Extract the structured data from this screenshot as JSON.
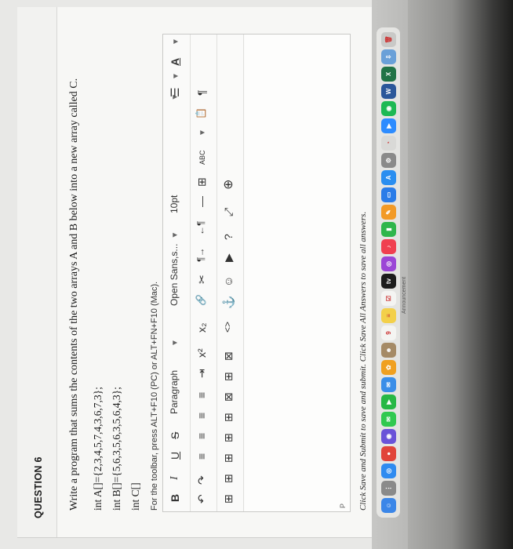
{
  "question": {
    "heading": "QUESTION 6",
    "prompt": "Write a program that sums the contents of the two arrays A and B below into a new array called C.",
    "code_lines": [
      "int A[]={2,3,4,5,7,4,3,6,7,3};",
      "int B[]={5,6,3,5,6,3,5,6,4,3};",
      "int C[]"
    ]
  },
  "editor": {
    "toolbar_hint": "For the toolbar, press ALT+F10 (PC) or ALT+FN+F10 (Mac).",
    "row1": {
      "bold": "B",
      "italic": "I",
      "underline": "U",
      "strike": "S",
      "paragraph": "Paragraph",
      "font": "Open Sans,s...",
      "size": "10pt",
      "list_icon": "☰",
      "text_color": "A"
    },
    "row2": {
      "undo": "↶",
      "redo": "↷",
      "align_left": "≡",
      "align_center": "≡",
      "align_right": "≡",
      "justify": "≡",
      "indent": "⇥",
      "superscript": "x²",
      "subscript": "x₂",
      "link": "🔗",
      "unlink": "✂",
      "ltr": "¶→",
      "rtl": "←¶",
      "hr": "—",
      "special": "⊞",
      "spellcheck": "ABC",
      "paste": "📋",
      "para_mark": "¶"
    },
    "row3": {
      "table_insert": "⊞",
      "table_props": "⊞",
      "row_before": "⊞",
      "row_after": "⊞",
      "col": "⊞",
      "del_table": "⊠",
      "cell_merge": "⊞",
      "cell_split": "⊠",
      "code": "<>",
      "anchor": "⚓",
      "emoji": "☺",
      "media": "▶",
      "help": "?",
      "fullscreen": "⤢",
      "add": "⊕"
    },
    "status_path": "P"
  },
  "footer_note": "Click Save and Submit to save and submit. Click Save All Answers to save all answers.",
  "dock": {
    "apps": [
      {
        "name": "finder",
        "color": "#3b86e8",
        "glyph": "☺"
      },
      {
        "name": "launchpad",
        "color": "#8a8a8a",
        "glyph": "⋮"
      },
      {
        "name": "safari",
        "color": "#2f8bf0",
        "glyph": "◎"
      },
      {
        "name": "chrome",
        "color": "#e1443a",
        "glyph": "●"
      },
      {
        "name": "siri",
        "color": "#6a53d8",
        "glyph": "◉"
      },
      {
        "name": "messages",
        "color": "#31c950",
        "glyph": "✉"
      },
      {
        "name": "facetime",
        "color": "#27b845",
        "glyph": "▶"
      },
      {
        "name": "mail",
        "color": "#3a8ee8",
        "glyph": "✉"
      },
      {
        "name": "photos",
        "color": "#f0a020",
        "glyph": "✿"
      },
      {
        "name": "contacts",
        "color": "#a58a66",
        "glyph": "☻"
      },
      {
        "name": "calendar",
        "color": "#f4f4f2",
        "glyph": "9"
      },
      {
        "name": "notes",
        "color": "#f3d04a",
        "glyph": "≡"
      },
      {
        "name": "reminders",
        "color": "#f4f4f2",
        "glyph": "☑"
      },
      {
        "name": "tv",
        "color": "#1c1c1c",
        "glyph": "tv"
      },
      {
        "name": "podcasts",
        "color": "#9b46d6",
        "glyph": "◎"
      },
      {
        "name": "music",
        "color": "#f04050",
        "glyph": "♪"
      },
      {
        "name": "numbers",
        "color": "#2fb64c",
        "glyph": "▮"
      },
      {
        "name": "pages",
        "color": "#f29a26",
        "glyph": "✎"
      },
      {
        "name": "keynote",
        "color": "#2a7ce8",
        "glyph": "▭"
      },
      {
        "name": "appstore",
        "color": "#2a8ef0",
        "glyph": "A"
      },
      {
        "name": "settings",
        "color": "#8a8a8a",
        "glyph": "⚙"
      },
      {
        "name": "preview",
        "color": "#d9d9d7",
        "glyph": "◔"
      },
      {
        "name": "zoom",
        "color": "#2d8cff",
        "glyph": "▶"
      },
      {
        "name": "spotify",
        "color": "#1db954",
        "glyph": "◉"
      },
      {
        "name": "word",
        "color": "#2b579a",
        "glyph": "W"
      },
      {
        "name": "excel",
        "color": "#217346",
        "glyph": "X"
      },
      {
        "name": "downloads",
        "color": "#6aa0d8",
        "glyph": "⇩"
      },
      {
        "name": "trash",
        "color": "#c9c9c7",
        "glyph": "🗑"
      }
    ],
    "label": "Announcement"
  }
}
